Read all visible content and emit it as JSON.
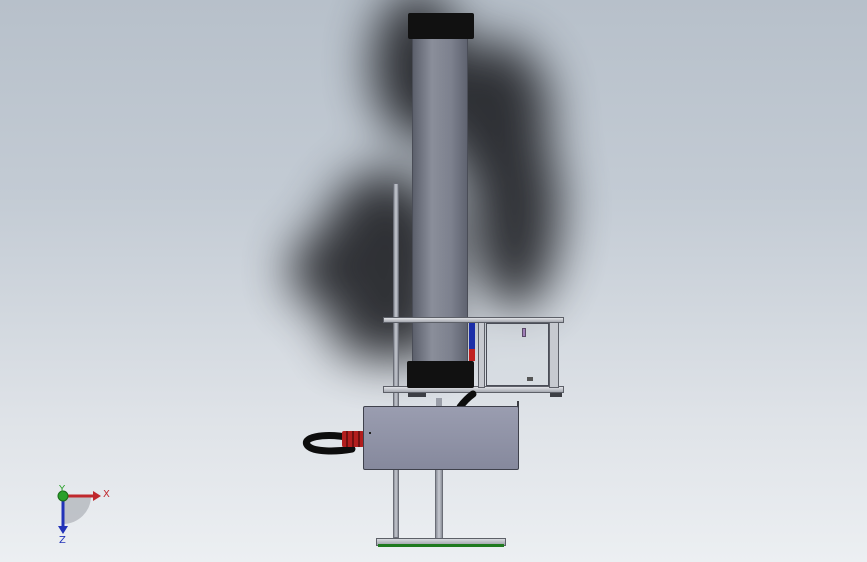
{
  "viewport": {
    "background_top": "#b7c0ca",
    "background_bottom": "#eceff2",
    "shadow_color": "#1a1b1f"
  },
  "model": {
    "tube_color": "#7c808e",
    "cap_color": "#111111",
    "housing_color": "#8d90a4",
    "frame_color": "#c2c5cc",
    "hose_color": "#0d0d0d",
    "fitting_color": "#b21d1d",
    "accent_blue": "#1b2ea8",
    "accent_red": "#c02020",
    "base_stripe_color": "#1f7a1f"
  },
  "triad": {
    "x_label": "X",
    "y_label": "Y",
    "z_label": "Z",
    "x_color": "#c0282d",
    "y_color": "#2aa02a",
    "z_color": "#2233b8"
  }
}
